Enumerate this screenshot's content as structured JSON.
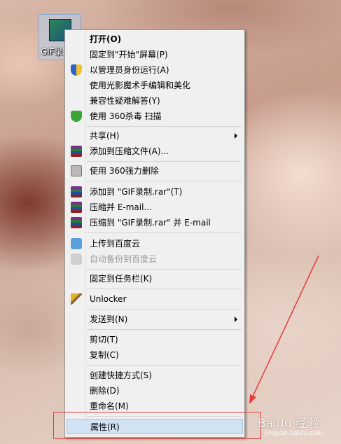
{
  "desktop": {
    "icon_label": "GIF录"
  },
  "menu": {
    "items": [
      {
        "label": "打开(O)",
        "icon": "none"
      },
      {
        "label": "固定到\"开始\"屏幕(P)",
        "icon": "none"
      },
      {
        "label": "以管理员身份运行(A)",
        "icon": "uac-shield-icon"
      },
      {
        "label": "使用光影魔术手编辑和美化",
        "icon": "none"
      },
      {
        "label": "兼容性疑难解答(Y)",
        "icon": "none"
      },
      {
        "label": "使用 360杀毒 扫描",
        "icon": "360-shield-icon"
      },
      {
        "label": "共享(H)",
        "icon": "none"
      },
      {
        "label": "添加到压缩文件(A)...",
        "icon": "winrar-icon"
      },
      {
        "label": "使用 360强力删除",
        "icon": "shredder-icon"
      },
      {
        "label": "添加到 \"GIF录制.rar\"(T)",
        "icon": "winrar-icon"
      },
      {
        "label": "压缩并 E-mail...",
        "icon": "winrar-icon"
      },
      {
        "label": "压缩到 \"GIF录制.rar\" 并 E-mail",
        "icon": "winrar-icon"
      },
      {
        "label": "上传到百度云",
        "icon": "baidu-cloud-icon"
      },
      {
        "label": "自动备份到百度云",
        "icon": "baidu-cloud-icon"
      },
      {
        "label": "固定到任务栏(K)",
        "icon": "none"
      },
      {
        "label": "Unlocker",
        "icon": "unlocker-wand-icon"
      },
      {
        "label": "发送到(N)",
        "icon": "none"
      },
      {
        "label": "剪切(T)",
        "icon": "none"
      },
      {
        "label": "复制(C)",
        "icon": "none"
      },
      {
        "label": "创建快捷方式(S)",
        "icon": "none"
      },
      {
        "label": "删除(D)",
        "icon": "none"
      },
      {
        "label": "重命名(M)",
        "icon": "none"
      },
      {
        "label": "属性(R)",
        "icon": "none"
      }
    ]
  },
  "annotation": {
    "highlight_color": "#e53a3a"
  },
  "watermark": {
    "text": "Baidu 经验",
    "sub": "jingyan.baidu.com"
  }
}
